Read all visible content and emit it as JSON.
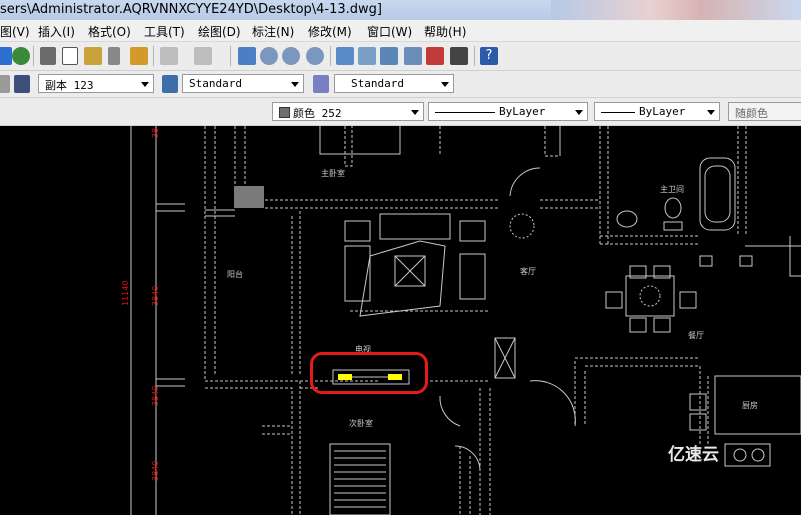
{
  "window": {
    "title": "sers\\Administrator.AQRVNNXCYYE24YD\\Desktop\\4-13.dwg]"
  },
  "menu": {
    "items": [
      "图(V)",
      "插入(I)",
      "格式(O)",
      "工具(T)",
      "绘图(D)",
      "标注(N)",
      "修改(M)",
      "窗口(W)",
      "帮助(H)"
    ]
  },
  "toolbar2": {
    "dim_style": "副本 123",
    "text_style": "Standard",
    "table_style": "Standard"
  },
  "toolbar3": {
    "color": "颜色 252",
    "linetype": "ByLayer",
    "lineweight": "ByLayer",
    "plotstyle": "随颜色"
  },
  "drawing": {
    "rooms": {
      "master_bedroom": "主卧室",
      "master_bath": "主卫间",
      "balcony": "阳台",
      "living": "客厅",
      "dining": "餐厅",
      "kitchen": "厨房",
      "second_bedroom": "次卧室",
      "tv": "电视"
    },
    "dimensions": {
      "d1": "3840",
      "d2": "11140",
      "d3": "3840",
      "d4": "3840",
      "top": "38"
    }
  },
  "watermark": "亿速云",
  "colors": {
    "wall": "#c8c8c8",
    "dimension": "#e01010",
    "highlight": "#e31b1b",
    "tv": "#ffff00"
  }
}
